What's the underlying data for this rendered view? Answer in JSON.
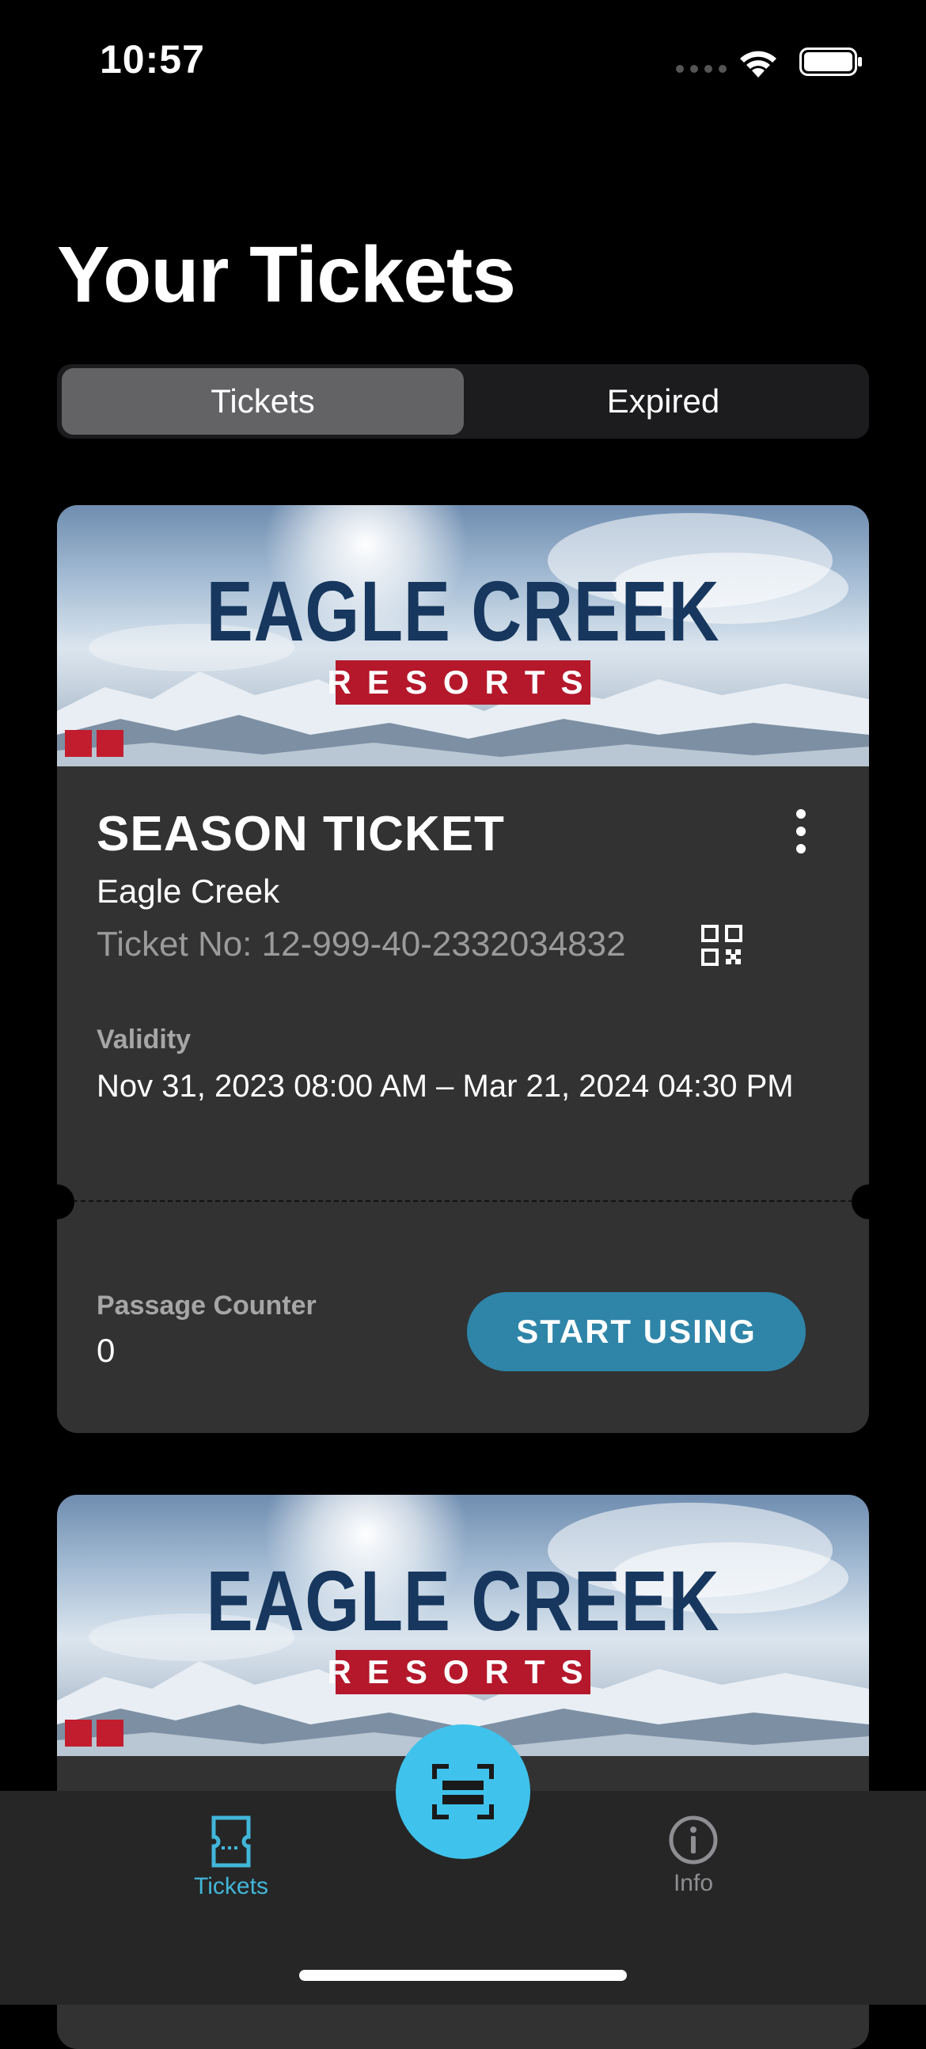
{
  "status_bar": {
    "time": "10:57"
  },
  "header": {
    "title": "Your Tickets"
  },
  "segments": [
    {
      "label": "Tickets",
      "selected": true
    },
    {
      "label": "Expired",
      "selected": false
    }
  ],
  "tickets": [
    {
      "brand": {
        "name": "EAGLE CREEK",
        "subtitle": "RESORTS"
      },
      "type": "SEASON TICKET",
      "resort": "Eagle Creek",
      "ticket_no": "Ticket No: 12-999-40-2332034832",
      "validity_label": "Validity",
      "validity": "Nov 31, 2023 08:00 AM – Mar 21, 2024 04:30 PM",
      "passage_label": "Passage Counter",
      "passage_count": "0",
      "start_button": "START USING"
    },
    {
      "brand": {
        "name": "EAGLE CREEK",
        "subtitle": "RESORTS"
      }
    }
  ],
  "tab_bar": {
    "tickets_label": "Tickets",
    "info_label": "Info",
    "active": "Tickets",
    "accent_color": "#41b6d9"
  },
  "icons": [
    "more-vertical-icon",
    "qr-code-icon",
    "ticket-icon",
    "info-icon",
    "scan-icon",
    "wifi-icon",
    "battery-icon"
  ]
}
